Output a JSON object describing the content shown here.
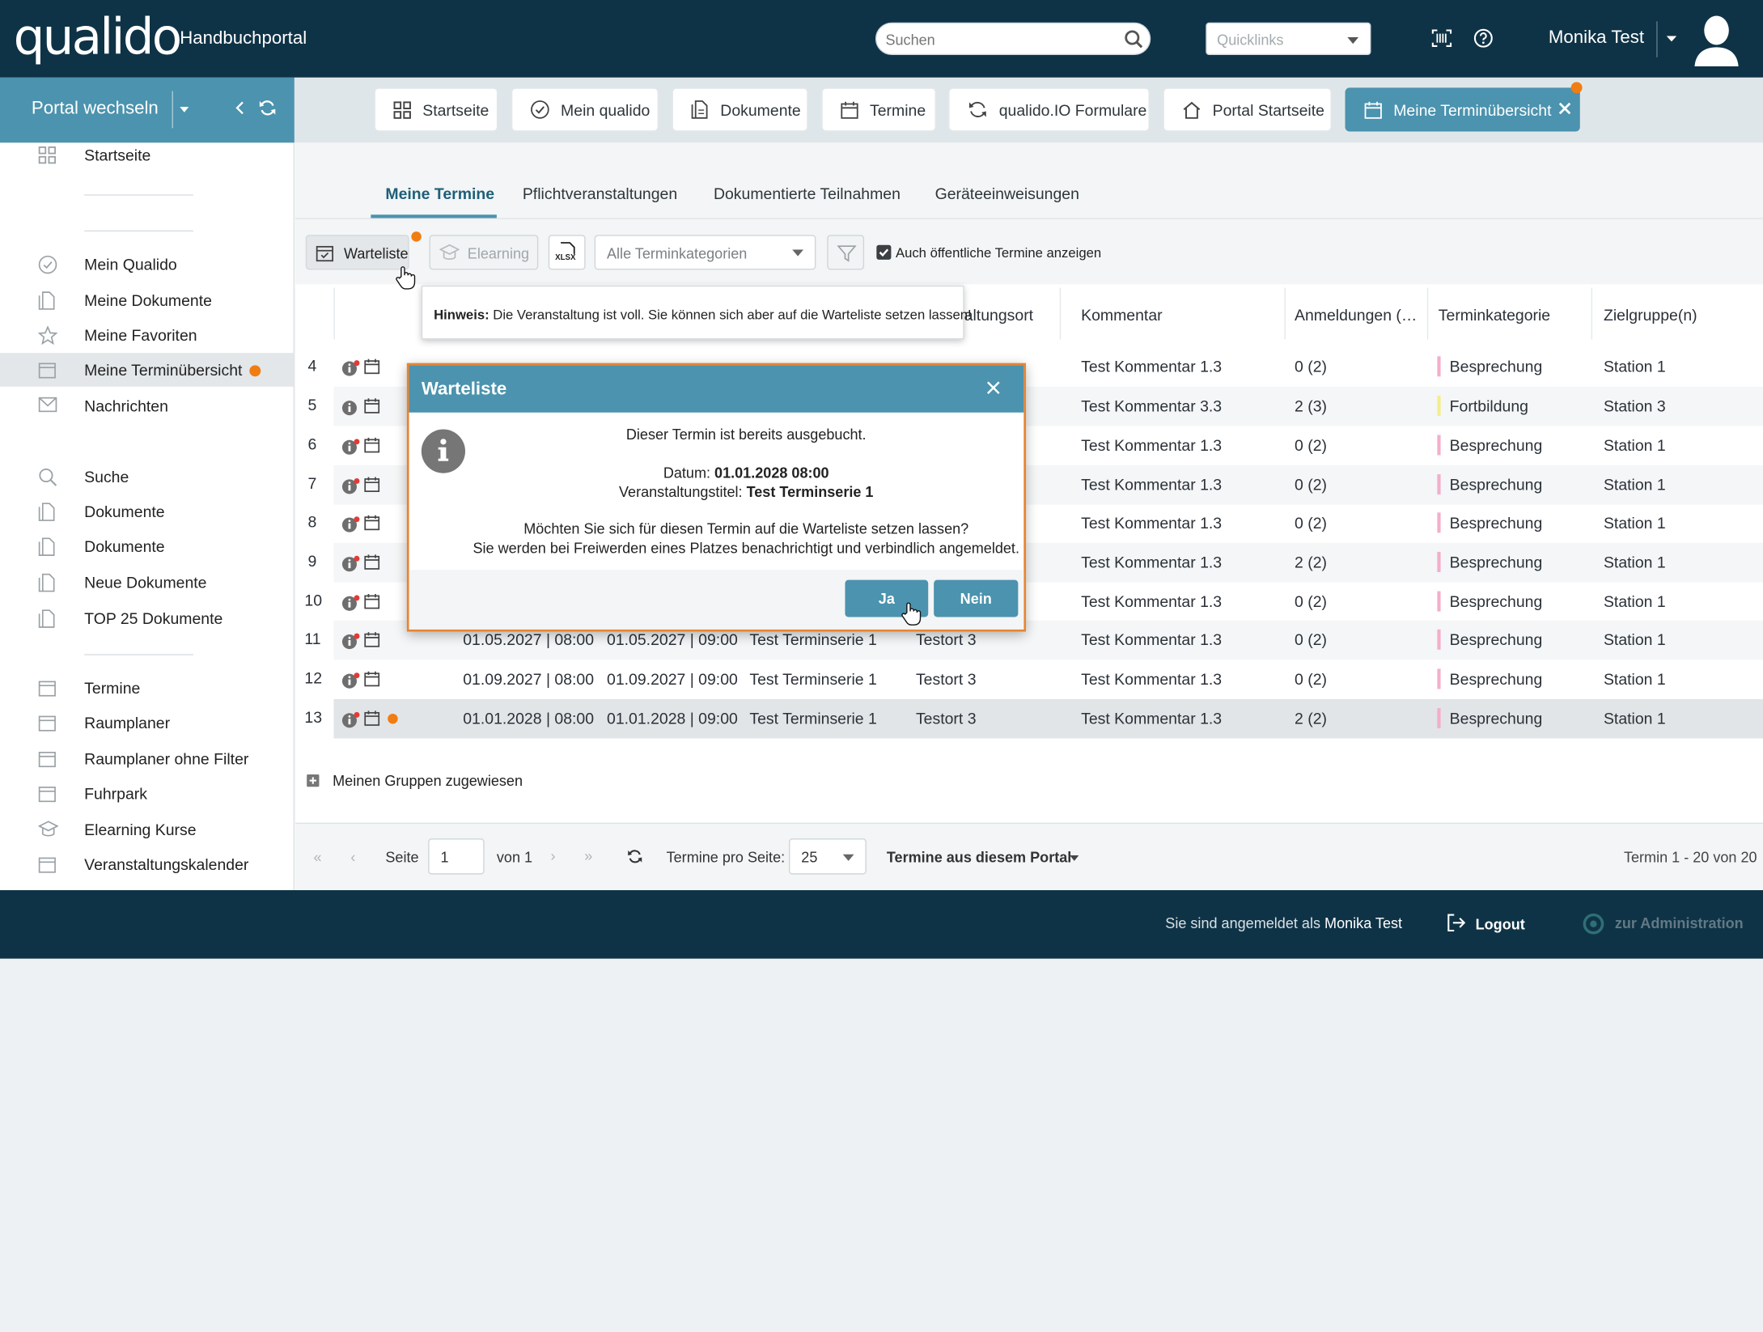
{
  "app": {
    "logo": "qualido",
    "portal_title": "Handbuchportal"
  },
  "header": {
    "search_placeholder": "Suchen",
    "quicklinks_placeholder": "Quicklinks",
    "user_name": "Monika Test"
  },
  "portal_switch": {
    "label": "Portal wechseln"
  },
  "nav_tabs": [
    {
      "label": "Startseite",
      "icon": "grid-icon"
    },
    {
      "label": "Mein qualido",
      "icon": "check-circle-icon"
    },
    {
      "label": "Dokumente",
      "icon": "documents-icon"
    },
    {
      "label": "Termine",
      "icon": "calendar-icon"
    },
    {
      "label": "qualido.IO Formulare",
      "icon": "sync-icon"
    },
    {
      "label": "Portal Startseite",
      "icon": "home-icon"
    },
    {
      "label": "Meine Terminübersicht",
      "icon": "calendar-icon",
      "active": true
    }
  ],
  "sidebar": {
    "items": [
      {
        "label": "Startseite",
        "icon": "grid-icon"
      },
      {
        "label": "Mein Qualido",
        "icon": "check-circle-icon"
      },
      {
        "label": "Meine Dokumente",
        "icon": "document-icon"
      },
      {
        "label": "Meine Favoriten",
        "icon": "star-icon"
      },
      {
        "label": "Meine Terminübersicht",
        "icon": "calendar-icon",
        "active": true
      },
      {
        "label": "Nachrichten",
        "icon": "mail-icon"
      },
      {
        "label": "Suche",
        "icon": "search-icon"
      },
      {
        "label": "Dokumente",
        "icon": "document-icon"
      },
      {
        "label": "Dokumente",
        "icon": "document-icon"
      },
      {
        "label": "Neue Dokumente",
        "icon": "document-icon"
      },
      {
        "label": "TOP 25 Dokumente",
        "icon": "document-icon"
      },
      {
        "label": "Termine",
        "icon": "calendar-icon"
      },
      {
        "label": "Raumplaner",
        "icon": "calendar-icon"
      },
      {
        "label": "Raumplaner ohne Filter",
        "icon": "calendar-icon"
      },
      {
        "label": "Fuhrpark",
        "icon": "calendar-icon"
      },
      {
        "label": "Elearning Kurse",
        "icon": "graduation-icon"
      },
      {
        "label": "Veranstaltungskalender",
        "icon": "calendar-icon"
      }
    ]
  },
  "sub_tabs": [
    "Meine Termine",
    "Pflichtveranstaltungen",
    "Dokumentierte Teilnahmen",
    "Geräteeinweisungen"
  ],
  "toolbar": {
    "warteliste": "Warteliste",
    "elearning": "Elearning",
    "xlsx": "XLSX",
    "category_select": "Alle Terminkategorien",
    "public_checkbox": "Auch öffentliche Termine anzeigen"
  },
  "tooltip": {
    "bold": "Hinweis:",
    "text": " Die Veranstaltung ist voll. Sie können sich aber auf die Warteliste setzen lassen!"
  },
  "table": {
    "headers": {
      "ort": "altungsort",
      "kommentar": "Kommentar",
      "anmeldungen": "Anmeldungen (…",
      "kategorie": "Terminkategorie",
      "zielgruppe": "Zielgruppe(n)"
    },
    "rows": [
      {
        "n": "4",
        "start": "",
        "end": "",
        "titel": "",
        "ort": "",
        "kommentar": "Test Kommentar 1.3",
        "anmeldungen": "0 (2)",
        "kategorie": "Besprechung",
        "ziel": "Station 1"
      },
      {
        "n": "5",
        "start": "",
        "end": "",
        "titel": "",
        "ort": "",
        "kommentar": "Test Kommentar 3.3",
        "anmeldungen": "2 (3)",
        "kategorie": "Fortbildung",
        "ziel": "Station 3"
      },
      {
        "n": "6",
        "start": "",
        "end": "",
        "titel": "",
        "ort": "",
        "kommentar": "Test Kommentar 1.3",
        "anmeldungen": "0 (2)",
        "kategorie": "Besprechung",
        "ziel": "Station 1"
      },
      {
        "n": "7",
        "start": "",
        "end": "",
        "titel": "",
        "ort": "",
        "kommentar": "Test Kommentar 1.3",
        "anmeldungen": "0 (2)",
        "kategorie": "Besprechung",
        "ziel": "Station 1"
      },
      {
        "n": "8",
        "start": "",
        "end": "",
        "titel": "",
        "ort": "",
        "kommentar": "Test Kommentar 1.3",
        "anmeldungen": "0 (2)",
        "kategorie": "Besprechung",
        "ziel": "Station 1"
      },
      {
        "n": "9",
        "start": "",
        "end": "",
        "titel": "",
        "ort": "",
        "kommentar": "Test Kommentar 1.3",
        "anmeldungen": "2 (2)",
        "kategorie": "Besprechung",
        "ziel": "Station 1"
      },
      {
        "n": "10",
        "start": "",
        "end": "",
        "titel": "",
        "ort": "",
        "kommentar": "Test Kommentar 1.3",
        "anmeldungen": "0 (2)",
        "kategorie": "Besprechung",
        "ziel": "Station 1"
      },
      {
        "n": "11",
        "start": "01.05.2027 | 08:00",
        "end": "01.05.2027 | 09:00",
        "titel": "Test Terminserie 1",
        "ort": "Testort 3",
        "kommentar": "Test Kommentar 1.3",
        "anmeldungen": "0 (2)",
        "kategorie": "Besprechung",
        "ziel": "Station 1"
      },
      {
        "n": "12",
        "start": "01.09.2027 | 08:00",
        "end": "01.09.2027 | 09:00",
        "titel": "Test Terminserie 1",
        "ort": "Testort 3",
        "kommentar": "Test Kommentar 1.3",
        "anmeldungen": "0 (2)",
        "kategorie": "Besprechung",
        "ziel": "Station 1"
      },
      {
        "n": "13",
        "start": "01.01.2028 | 08:00",
        "end": "01.01.2028 | 09:00",
        "titel": "Test Terminserie 1",
        "ort": "Testort 3",
        "kommentar": "Test Kommentar 1.3",
        "anmeldungen": "2 (2)",
        "kategorie": "Besprechung",
        "ziel": "Station 1"
      }
    ]
  },
  "dialog": {
    "title": "Warteliste",
    "line1": "Dieser Termin ist bereits ausgebucht.",
    "datum_label": "Datum: ",
    "datum_value": "01.01.2028 08:00",
    "titel_label": "Veranstaltungstitel: ",
    "titel_value": "Test Terminserie 1",
    "question": "Möchten Sie sich für diesen Termin auf die Warteliste setzen lassen?",
    "note": "Sie werden bei Freiwerden eines Platzes benachrichtigt und verbindlich angemeldet.",
    "yes": "Ja",
    "no": "Nein"
  },
  "group": {
    "label": "Meinen Gruppen zugewiesen"
  },
  "pager": {
    "seite_label": "Seite",
    "page_value": "1",
    "of_label": "von 1",
    "per_page_label": "Termine pro Seite:",
    "per_page_value": "25",
    "source_select": "Termine aus diesem Portal",
    "summary": "Termin 1 - 20 von 20"
  },
  "footer": {
    "logged_in_prefix": "Sie sind angemeldet als ",
    "logged_in_user": "Monika Test",
    "logout": "Logout",
    "admin": "zur Administration"
  },
  "colors": {
    "dark": "#0f3346",
    "accent": "#4b93ae",
    "notify": "#f07d12",
    "besprechung": "#f3aecb",
    "fortbildung": "#f3ef8a"
  }
}
